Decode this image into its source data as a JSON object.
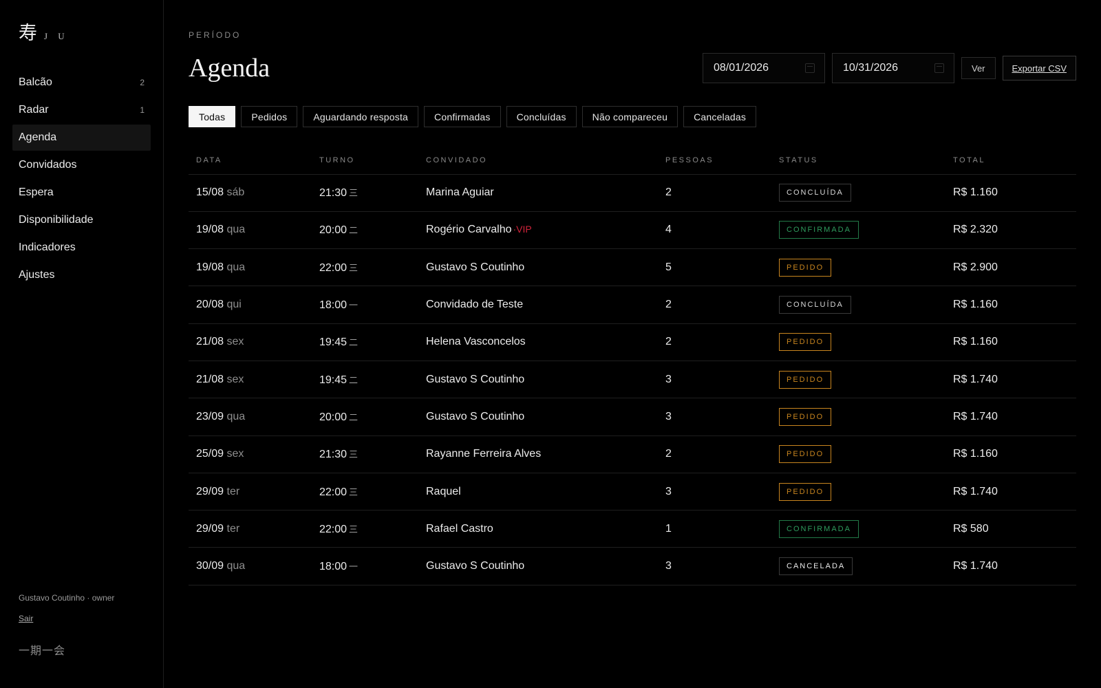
{
  "brand": {
    "kanji": "寿",
    "name": "J U"
  },
  "sidebar": {
    "items": [
      {
        "label": "Balcão",
        "count": "2"
      },
      {
        "label": "Radar",
        "count": "1"
      },
      {
        "label": "Agenda",
        "count": ""
      },
      {
        "label": "Convidados",
        "count": ""
      },
      {
        "label": "Espera",
        "count": ""
      },
      {
        "label": "Disponibilidade",
        "count": ""
      },
      {
        "label": "Indicadores",
        "count": ""
      },
      {
        "label": "Ajustes",
        "count": ""
      }
    ],
    "active": "Agenda",
    "user": "Gustavo Coutinho · owner",
    "logout_label": "Sair",
    "motto": "一期一会"
  },
  "header": {
    "eyebrow": "PERÍODO",
    "title": "Agenda",
    "date_from": "08/01/2026",
    "date_to": "10/31/2026",
    "view_label": "Ver",
    "export_label": "Exportar CSV"
  },
  "filters": {
    "items": [
      "Todas",
      "Pedidos",
      "Aguardando resposta",
      "Confirmadas",
      "Concluídas",
      "Não compareceu",
      "Canceladas"
    ],
    "active": "Todas"
  },
  "table": {
    "headers": [
      "DATA",
      "TURNO",
      "CONVIDADO",
      "PESSOAS",
      "STATUS",
      "TOTAL"
    ],
    "rows": [
      {
        "date": "15/08",
        "weekday": "sáb",
        "time": "21:30",
        "shift": "三",
        "guest": "Marina Aguiar",
        "vip": "",
        "people": "2",
        "status": "CONCLUÍDA",
        "status_kind": "concluida",
        "total": "R$ 1.160"
      },
      {
        "date": "19/08",
        "weekday": "qua",
        "time": "20:00",
        "shift": "二",
        "guest": "Rogério Carvalho",
        "vip": "·VIP",
        "people": "4",
        "status": "CONFIRMADA",
        "status_kind": "confirmada",
        "total": "R$ 2.320"
      },
      {
        "date": "19/08",
        "weekday": "qua",
        "time": "22:00",
        "shift": "三",
        "guest": "Gustavo S Coutinho",
        "vip": "",
        "people": "5",
        "status": "PEDIDO",
        "status_kind": "pedido",
        "total": "R$ 2.900"
      },
      {
        "date": "20/08",
        "weekday": "qui",
        "time": "18:00",
        "shift": "一",
        "guest": "Convidado de Teste",
        "vip": "",
        "people": "2",
        "status": "CONCLUÍDA",
        "status_kind": "concluida",
        "total": "R$ 1.160"
      },
      {
        "date": "21/08",
        "weekday": "sex",
        "time": "19:45",
        "shift": "二",
        "guest": "Helena Vasconcelos",
        "vip": "",
        "people": "2",
        "status": "PEDIDO",
        "status_kind": "pedido",
        "total": "R$ 1.160"
      },
      {
        "date": "21/08",
        "weekday": "sex",
        "time": "19:45",
        "shift": "二",
        "guest": "Gustavo S Coutinho",
        "vip": "",
        "people": "3",
        "status": "PEDIDO",
        "status_kind": "pedido",
        "total": "R$ 1.740"
      },
      {
        "date": "23/09",
        "weekday": "qua",
        "time": "20:00",
        "shift": "二",
        "guest": "Gustavo S Coutinho",
        "vip": "",
        "people": "3",
        "status": "PEDIDO",
        "status_kind": "pedido",
        "total": "R$ 1.740"
      },
      {
        "date": "25/09",
        "weekday": "sex",
        "time": "21:30",
        "shift": "三",
        "guest": "Rayanne Ferreira Alves",
        "vip": "",
        "people": "2",
        "status": "PEDIDO",
        "status_kind": "pedido",
        "total": "R$ 1.160"
      },
      {
        "date": "29/09",
        "weekday": "ter",
        "time": "22:00",
        "shift": "三",
        "guest": "Raquel",
        "vip": "",
        "people": "3",
        "status": "PEDIDO",
        "status_kind": "pedido",
        "total": "R$ 1.740"
      },
      {
        "date": "29/09",
        "weekday": "ter",
        "time": "22:00",
        "shift": "三",
        "guest": "Rafael Castro",
        "vip": "",
        "people": "1",
        "status": "CONFIRMADA",
        "status_kind": "confirmada",
        "total": "R$ 580"
      },
      {
        "date": "30/09",
        "weekday": "qua",
        "time": "18:00",
        "shift": "一",
        "guest": "Gustavo S Coutinho",
        "vip": "",
        "people": "3",
        "status": "CANCELADA",
        "status_kind": "cancelada",
        "total": "R$ 1.740"
      }
    ]
  }
}
